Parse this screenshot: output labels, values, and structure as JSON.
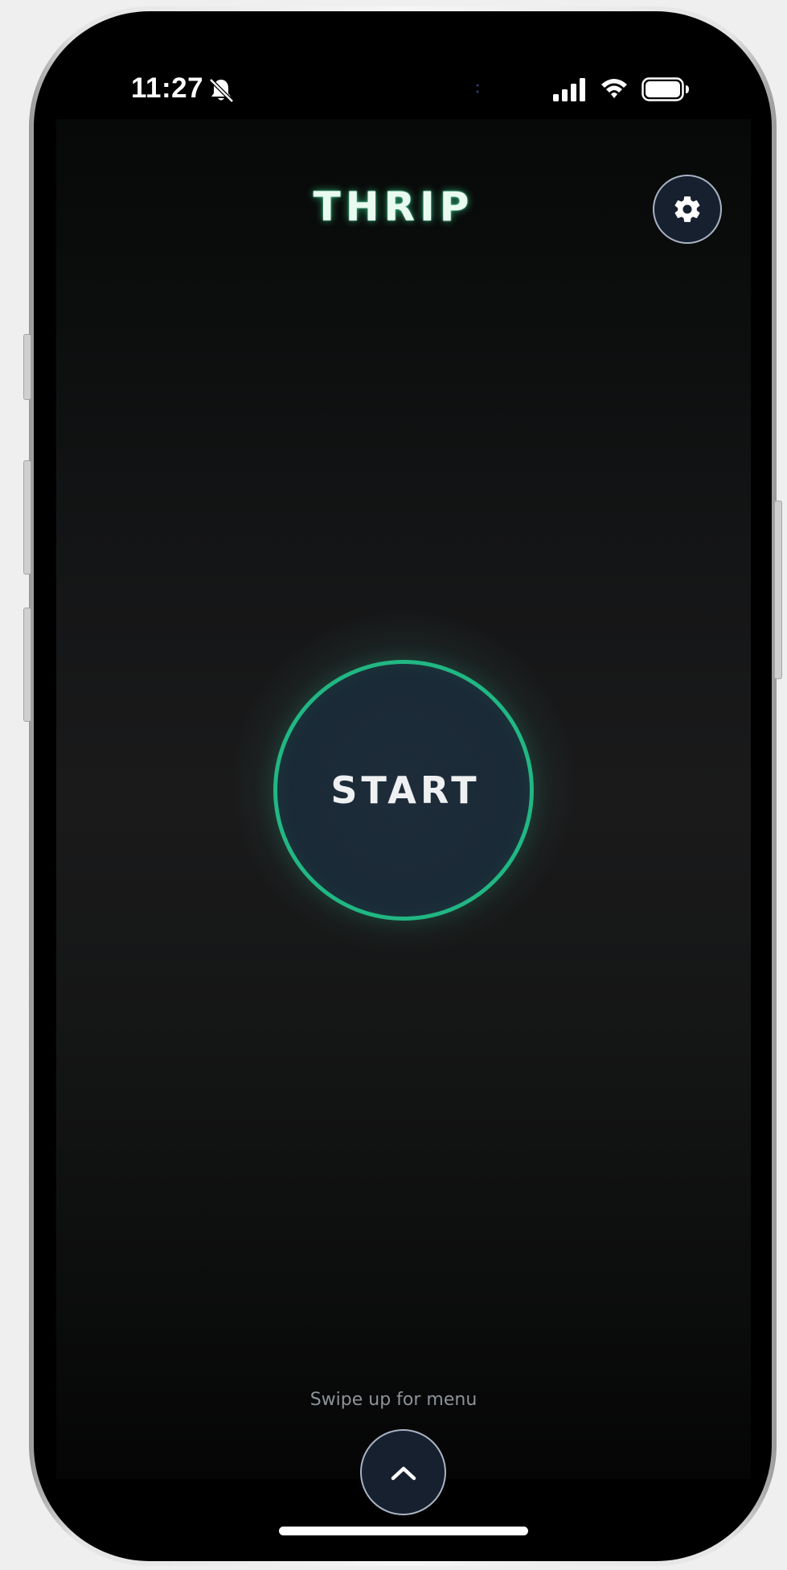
{
  "status_bar": {
    "time": "11:27",
    "icons": [
      "bell-slash-icon",
      "signal-bars-icon",
      "wifi-icon",
      "battery-icon"
    ]
  },
  "header": {
    "title": "THRIP",
    "settings_icon": "gear-icon"
  },
  "main": {
    "start_label": "START"
  },
  "footer": {
    "swipe_hint": "Swipe up for menu",
    "menu_icon": "chevron-up-icon"
  },
  "colors": {
    "accent": "#21b783",
    "background": "#141516",
    "button_fill": "#1b2a37",
    "title_glow": "#3cdc96"
  }
}
